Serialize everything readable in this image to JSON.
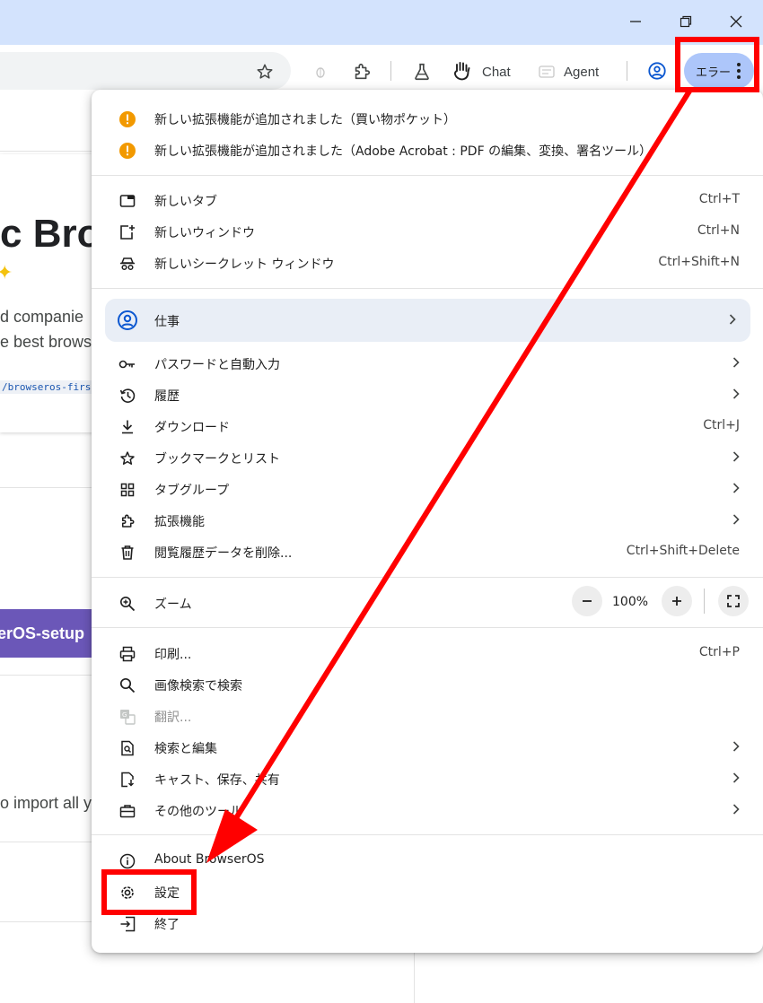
{
  "toolbar": {
    "chat_label": "Chat",
    "agent_label": "Agent",
    "profile_error": "エラー"
  },
  "background": {
    "heading": "c Bro",
    "line1": "d companie",
    "line2": "e best brows",
    "code": "/browseros-first-r",
    "setup_button": "erOS-setup",
    "import_text": "o import all y"
  },
  "notifications": [
    {
      "icon": "warning-icon",
      "label": "新しい拡張機能が追加されました（買い物ポケット）"
    },
    {
      "icon": "warning-icon",
      "label": "新しい拡張機能が追加されました（Adobe Acrobat : PDF の編集、変換、署名ツール）"
    }
  ],
  "menu": {
    "new_tab": {
      "label": "新しいタブ",
      "shortcut": "Ctrl+T"
    },
    "new_window": {
      "label": "新しいウィンドウ",
      "shortcut": "Ctrl+N"
    },
    "incognito": {
      "label": "新しいシークレット ウィンドウ",
      "shortcut": "Ctrl+Shift+N"
    },
    "profile": {
      "label": "仕事"
    },
    "passwords": {
      "label": "パスワードと自動入力"
    },
    "history": {
      "label": "履歴"
    },
    "downloads": {
      "label": "ダウンロード",
      "shortcut": "Ctrl+J"
    },
    "bookmarks": {
      "label": "ブックマークとリスト"
    },
    "tab_groups": {
      "label": "タブグループ"
    },
    "extensions": {
      "label": "拡張機能"
    },
    "clear_data": {
      "label": "閲覧履歴データを削除...",
      "shortcut": "Ctrl+Shift+Delete"
    },
    "zoom": {
      "label": "ズーム",
      "value": "100%"
    },
    "print": {
      "label": "印刷...",
      "shortcut": "Ctrl+P"
    },
    "image_search": {
      "label": "画像検索で検索"
    },
    "translate": {
      "label": "翻訳..."
    },
    "search_edit": {
      "label": "検索と編集"
    },
    "cast_save": {
      "label": "キャスト、保存、共有"
    },
    "more_tools": {
      "label": "その他のツール"
    },
    "about": {
      "label": "About BrowserOS"
    },
    "settings": {
      "label": "設定"
    },
    "exit": {
      "label": "終了"
    }
  },
  "colors": {
    "annotation": "#ff0000",
    "titlebar": "#d3e3fd",
    "warning": "#f29900",
    "profile_accent": "#0b57d0"
  }
}
